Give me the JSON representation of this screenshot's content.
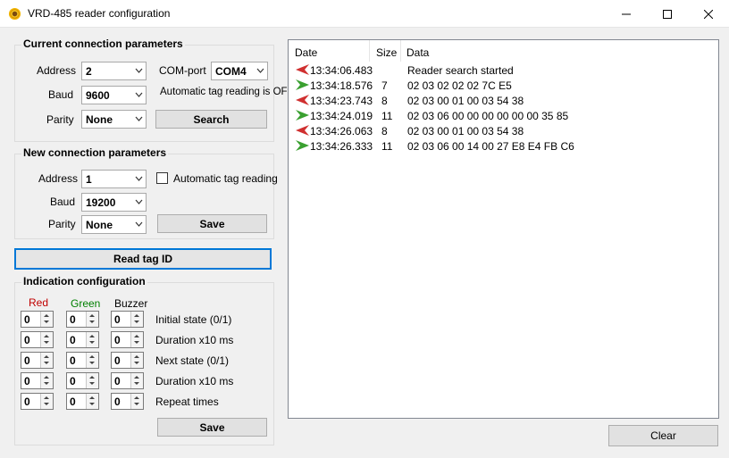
{
  "window": {
    "title": "VRD-485 reader configuration",
    "minimize_glyph": "—",
    "maximize_glyph": "☐",
    "close_glyph": "✕"
  },
  "current": {
    "title": "Current connection parameters",
    "address_label": "Address",
    "address_value": "2",
    "baud_label": "Baud",
    "baud_value": "9600",
    "parity_label": "Parity",
    "parity_value": "None",
    "comport_label": "COM-port",
    "comport_value": "COM4",
    "auto_status": "Automatic tag reading is OFF",
    "search_label": "Search"
  },
  "new_params": {
    "title": "New connection parameters",
    "address_label": "Address",
    "address_value": "1",
    "baud_label": "Baud",
    "baud_value": "19200",
    "parity_label": "Parity",
    "parity_value": "None",
    "auto_label": "Automatic tag reading",
    "save_label": "Save"
  },
  "read_tag_label": "Read tag ID",
  "indication": {
    "title": "Indication configuration",
    "headers": {
      "red": "Red",
      "green": "Green",
      "buzzer": "Buzzer"
    },
    "colors": {
      "red": "#c00000",
      "green": "#008000"
    },
    "rows": [
      {
        "label": "Initial state (0/1)",
        "red": "0",
        "green": "0",
        "buzzer": "0"
      },
      {
        "label": "Duration x10 ms",
        "red": "0",
        "green": "0",
        "buzzer": "0"
      },
      {
        "label": "Next state (0/1)",
        "red": "0",
        "green": "0",
        "buzzer": "0"
      },
      {
        "label": "Duration x10 ms",
        "red": "0",
        "green": "0",
        "buzzer": "0"
      },
      {
        "label": "Repeat times",
        "red": "0",
        "green": "0",
        "buzzer": "0"
      }
    ],
    "save_label": "Save"
  },
  "log": {
    "columns": {
      "date": "Date",
      "size": "Size",
      "data": "Data"
    },
    "rows": [
      {
        "direction": "sent",
        "date": "13:34:06.483",
        "size": "",
        "data": "Reader search started"
      },
      {
        "direction": "received",
        "date": "13:34:18.576",
        "size": "7",
        "data": "02 03 02 02 02 7C E5"
      },
      {
        "direction": "sent",
        "date": "13:34:23.743",
        "size": "8",
        "data": "02 03 00 01 00 03 54 38"
      },
      {
        "direction": "received",
        "date": "13:34:24.019",
        "size": "11",
        "data": "02 03 06 00 00 00 00 00 00 35 85"
      },
      {
        "direction": "sent",
        "date": "13:34:26.063",
        "size": "8",
        "data": "02 03 00 01 00 03 54 38"
      },
      {
        "direction": "received",
        "date": "13:34:26.333",
        "size": "11",
        "data": "02 03 06 00 14 00 27 E8 E4 FB C6"
      }
    ],
    "icon_colors": {
      "sent": "#d03030",
      "received": "#3aa030"
    }
  },
  "clear_label": "Clear"
}
